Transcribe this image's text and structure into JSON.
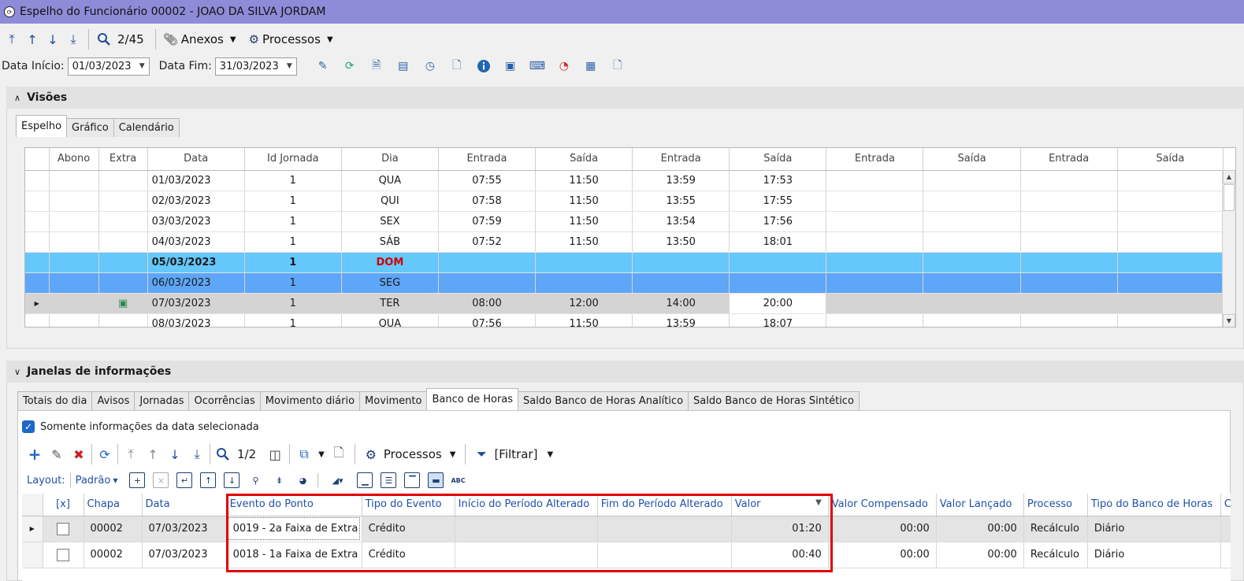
{
  "window": {
    "title": "Espelho do Funcionário 00002 - JOAO DA SILVA JORDAM"
  },
  "toolbar1": {
    "record_counter": "2/45",
    "anexos_label": "Anexos",
    "processos_label": "Processos"
  },
  "filters": {
    "data_inicio_label": "Data Início:",
    "data_inicio_value": "01/03/2023",
    "data_fim_label": "Data Fim:",
    "data_fim_value": "31/03/2023"
  },
  "visoes": {
    "title": "Visões",
    "tabs": [
      "Espelho",
      "Gráfico",
      "Calendário"
    ],
    "columns": [
      "Abono",
      "Extra",
      "Data",
      "Id Jornada",
      "Dia",
      "Entrada",
      "Saída",
      "Entrada",
      "Saída",
      "Entrada",
      "Saída",
      "Entrada",
      "Saída"
    ],
    "rows": [
      {
        "data": "01/03/2023",
        "jornada": "1",
        "dia": "QUA",
        "e1": "07:55",
        "s1": "11:50",
        "e2": "13:59",
        "s2": "17:53"
      },
      {
        "data": "02/03/2023",
        "jornada": "1",
        "dia": "QUI",
        "e1": "07:58",
        "s1": "11:50",
        "e2": "13:55",
        "s2": "17:55"
      },
      {
        "data": "03/03/2023",
        "jornada": "1",
        "dia": "SEX",
        "e1": "07:59",
        "s1": "11:50",
        "e2": "13:54",
        "s2": "17:56"
      },
      {
        "data": "04/03/2023",
        "jornada": "1",
        "dia": "SÁB",
        "e1": "07:52",
        "s1": "11:50",
        "e2": "13:50",
        "s2": "18:01"
      },
      {
        "data": "05/03/2023",
        "jornada": "1",
        "dia": "DOM",
        "e1": "",
        "s1": "",
        "e2": "",
        "s2": ""
      },
      {
        "data": "06/03/2023",
        "jornada": "1",
        "dia": "SEG",
        "e1": "",
        "s1": "",
        "e2": "",
        "s2": ""
      },
      {
        "data": "07/03/2023",
        "jornada": "1",
        "dia": "TER",
        "e1": "08:00",
        "s1": "12:00",
        "e2": "14:00",
        "s2": "20:00"
      },
      {
        "data": "08/03/2023",
        "jornada": "1",
        "dia": "QUA",
        "e1": "07:56",
        "s1": "11:50",
        "e2": "13:59",
        "s2": "18:07"
      }
    ]
  },
  "janelas": {
    "title": "Janelas de informações",
    "tabs": [
      "Totais do dia",
      "Avisos",
      "Jornadas",
      "Ocorrências",
      "Movimento diário",
      "Movimento",
      "Banco de Horas",
      "Saldo Banco de Horas Analítico",
      "Saldo Banco de Horas Sintético"
    ],
    "checkbox_label": "Somente informações da data selecionada",
    "toolbar": {
      "counter": "1/2",
      "processos_label": "Processos",
      "filtrar_label": "[Filtrar]"
    },
    "layout_label": "Layout:",
    "layout_value": "Padrão",
    "columns": [
      "[x]",
      "Chapa",
      "Data",
      "Evento do Ponto",
      "Tipo do Evento",
      "Início do Período Alterado",
      "Fim do Período Alterado",
      "Valor",
      "Valor Compensado",
      "Valor Lançado",
      "Processo",
      "Tipo do Banco de Horas",
      "C"
    ],
    "rows": [
      {
        "chapa": "00002",
        "data": "07/03/2023",
        "evento": "0019 - 2a Faixa de Extra",
        "tipo": "Crédito",
        "inicio": "",
        "fim": "",
        "valor": "01:20",
        "compensado": "00:00",
        "lancado": "00:00",
        "processo": "Recálculo",
        "tipo_banco": "Diário"
      },
      {
        "chapa": "00002",
        "data": "07/03/2023",
        "evento": "0018 - 1a Faixa de Extra",
        "tipo": "Crédito",
        "inicio": "",
        "fim": "",
        "valor": "00:40",
        "compensado": "00:00",
        "lancado": "00:00",
        "processo": "Recálculo",
        "tipo_banco": "Diário"
      }
    ]
  },
  "colors": {
    "titlebar": "#8e8cd8",
    "highlight_box": "#e00000",
    "row_sunday": "#66c7fa",
    "row_selected": "#5ea6f7"
  }
}
